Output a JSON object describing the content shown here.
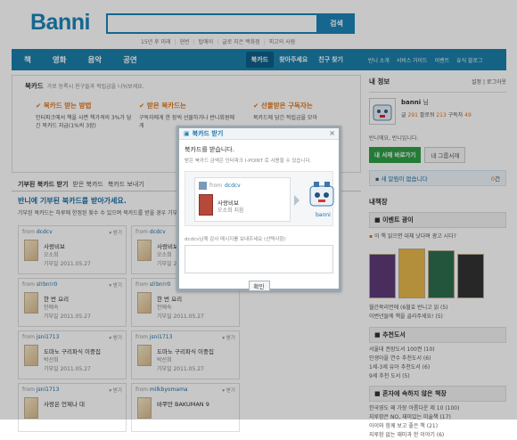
{
  "header": {
    "logo": "Banni",
    "search_button": "검색",
    "quick_links": [
      "15년 후 미래",
      "현빈",
      "탑애이",
      "글로 지은 백화점",
      "피고의 사람"
    ]
  },
  "nav": {
    "left": [
      "책",
      "영화",
      "음악",
      "공연"
    ],
    "middle": [
      "북카드",
      "찾아주세요",
      "친구 찾기"
    ],
    "right": [
      "반니 소개",
      "서비스 가이드",
      "이벤트",
      "유식 블로그"
    ]
  },
  "bookcard_intro": {
    "title": "북카드",
    "desc": "가로 등록시 친구들과 적립금을 나눠보세요.",
    "col1_title": "북카드 받는 방법",
    "col1_text": "인터파크에서 책을 사면 책가격의 3%가 담긴 북카드 지급(1%씩 3장)",
    "col2_title": "받은 북카드는",
    "col2_text": "구독자에게 한 장씩 선물하거나 반니회원에게",
    "col3_title": "선물받은 구독자는",
    "col3_text": "북카드에 담긴 적립금을 모아"
  },
  "tabs": {
    "received": "기부된 북카드 받기",
    "received_tab": "받은 북카드",
    "send_tab": "북카드 보내기"
  },
  "notice": {
    "title": "반니에 기부된 북카드를 받아가세요.",
    "desc": "기부된 북카드는 하루에 한정된 횟수 수 있으며 북카드를 받을 경우 기부"
  },
  "cards": [
    {
      "from": "dcdcv",
      "title": "사랑비보",
      "author": "오소희",
      "date_label": "기부일",
      "date": "2011.05.27",
      "btn": "받기"
    },
    {
      "from": "dcdcv",
      "title": "사랑비보",
      "author": "오소희",
      "date_label": "기부일",
      "date": "2011.05.27",
      "btn": "받기"
    },
    {
      "from": "sl!bn!r0",
      "title": "한 번 요리",
      "author": "한예숙",
      "date_label": "기부일",
      "date": "2011.05.27",
      "btn": "받기"
    },
    {
      "from": "sl!bn!r0",
      "title": "한 번 요리",
      "author": "한예숙",
      "date_label": "기부일",
      "date": "2011.05.27",
      "btn": "받기"
    },
    {
      "from": "jsni1713",
      "title": "도마노 구리파식 이중집",
      "author": "박선희",
      "date_label": "기부일",
      "date": "2011.05.27",
      "btn": "받기"
    },
    {
      "from": "jsni1713",
      "title": "도마노 구리파식 이중집",
      "author": "박선희",
      "date_label": "기부일",
      "date": "2011.05.27",
      "btn": "받기"
    },
    {
      "from": "jsni1713",
      "title": "사랑은 언제나 대",
      "author": "",
      "date_label": "",
      "date": "",
      "btn": "받기"
    },
    {
      "from": "milkbyomama",
      "title": "바쭈만 BAKUMAN 9",
      "author": "",
      "date_label": "",
      "date": "",
      "btn": "받기"
    }
  ],
  "sidebar": {
    "my_info_title": "내 정보",
    "settings": "설정",
    "logout": "로그아웃",
    "username": "banni",
    "name_suffix": "님",
    "points_label": "글",
    "points": "291",
    "liked_label": "팔로워",
    "liked": "213",
    "subs_label": "구독자",
    "subs": "49",
    "greeting": "반니에요, 반니입니다.",
    "my_shelf_btn": "내 서재 바로가기",
    "book_add_btn": "내 그룹서재",
    "alerts": "새 알림이 없습니다",
    "alerts_count": "0",
    "shelf_title": "내책장",
    "event_title": "이벤트 광이",
    "event_text": "이 책 읽으면 대체 낫다며 광고 시다?",
    "lines": [
      "월간북리먼에 (6월호 반니고 읽 (5)",
      "이번년들에 책을 골라주세요! (5)"
    ],
    "recommend_title": "추천도서",
    "rec_items": [
      "서울대 권장도서 100권 (10)",
      "인생아을 연수 추천도서 (6)",
      "1세-3세 유아 추천도서 (6)",
      "9세 추천 도서 (5)"
    ],
    "lit_title": "혼자에 속하지 않은 책장",
    "lit_items": [
      "한국영도 왜 가장 아름다운 제 10 (100)",
      "지루함은 NO, 재미있는 미술책 (17)",
      "아이와 함께 보고 좋은 책 (21)",
      "지루함 없는 재미과 한 이야기 (6)"
    ]
  },
  "modal": {
    "title": "북카드 받기",
    "close": "×",
    "line1": "북카드를 받습니다.",
    "line2": "받은 북카드 금액은 인터파크 I-POINT 로 사용할 수 있습니다.",
    "from_label": "from",
    "from_user": "dcdcv",
    "book_title": "사랑비보",
    "book_author": "오소희 지음",
    "to_user": "banni",
    "message_label": "dcdcv님께 감사 메시지를 보내주세요 (선택사항)",
    "confirm": "확인"
  }
}
